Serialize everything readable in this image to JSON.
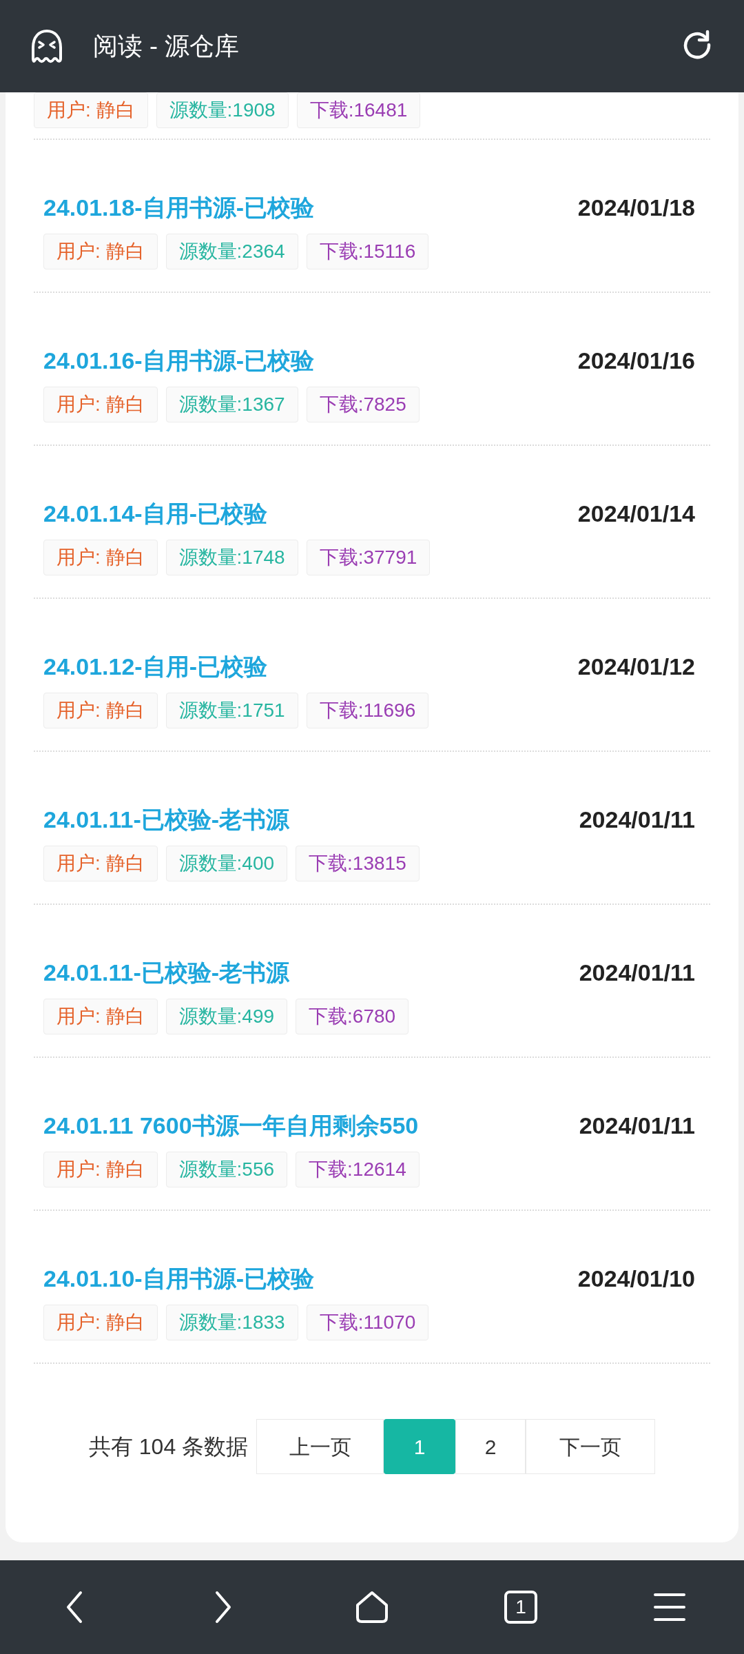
{
  "header": {
    "title": "阅读 - 源仓库"
  },
  "entries": [
    {
      "kind": "cut",
      "user": "用户: 静白",
      "count": "源数量:1908",
      "downloads": "下载:16481"
    },
    {
      "kind": "full",
      "title": "24.01.18-自用书源-已校验",
      "date": "2024/01/18",
      "user": "用户: 静白",
      "count": "源数量:2364",
      "downloads": "下载:15116"
    },
    {
      "kind": "full",
      "title": "24.01.16-自用书源-已校验",
      "date": "2024/01/16",
      "user": "用户: 静白",
      "count": "源数量:1367",
      "downloads": "下载:7825"
    },
    {
      "kind": "full",
      "title": "24.01.14-自用-已校验",
      "date": "2024/01/14",
      "user": "用户: 静白",
      "count": "源数量:1748",
      "downloads": "下载:37791"
    },
    {
      "kind": "full",
      "title": "24.01.12-自用-已校验",
      "date": "2024/01/12",
      "user": "用户: 静白",
      "count": "源数量:1751",
      "downloads": "下载:11696"
    },
    {
      "kind": "full",
      "title": "24.01.11-已校验-老书源",
      "date": "2024/01/11",
      "user": "用户: 静白",
      "count": "源数量:400",
      "downloads": "下载:13815"
    },
    {
      "kind": "full",
      "title": "24.01.11-已校验-老书源",
      "date": "2024/01/11",
      "user": "用户: 静白",
      "count": "源数量:499",
      "downloads": "下载:6780"
    },
    {
      "kind": "full",
      "title": "24.01.11 7600书源一年自用剩余550",
      "date": "2024/01/11",
      "user": "用户: 静白",
      "count": "源数量:556",
      "downloads": "下载:12614"
    },
    {
      "kind": "full",
      "title": "24.01.10-自用书源-已校验",
      "date": "2024/01/10",
      "user": "用户: 静白",
      "count": "源数量:1833",
      "downloads": "下载:11070"
    }
  ],
  "pagination": {
    "total": "共有 104 条数据",
    "buttons": [
      {
        "label": "上一页",
        "selected": false
      },
      {
        "label": "1",
        "selected": true
      },
      {
        "label": "2",
        "selected": false
      },
      {
        "label": "下一页",
        "selected": false
      }
    ]
  },
  "bottom_bar": {
    "tab_count": "1"
  }
}
